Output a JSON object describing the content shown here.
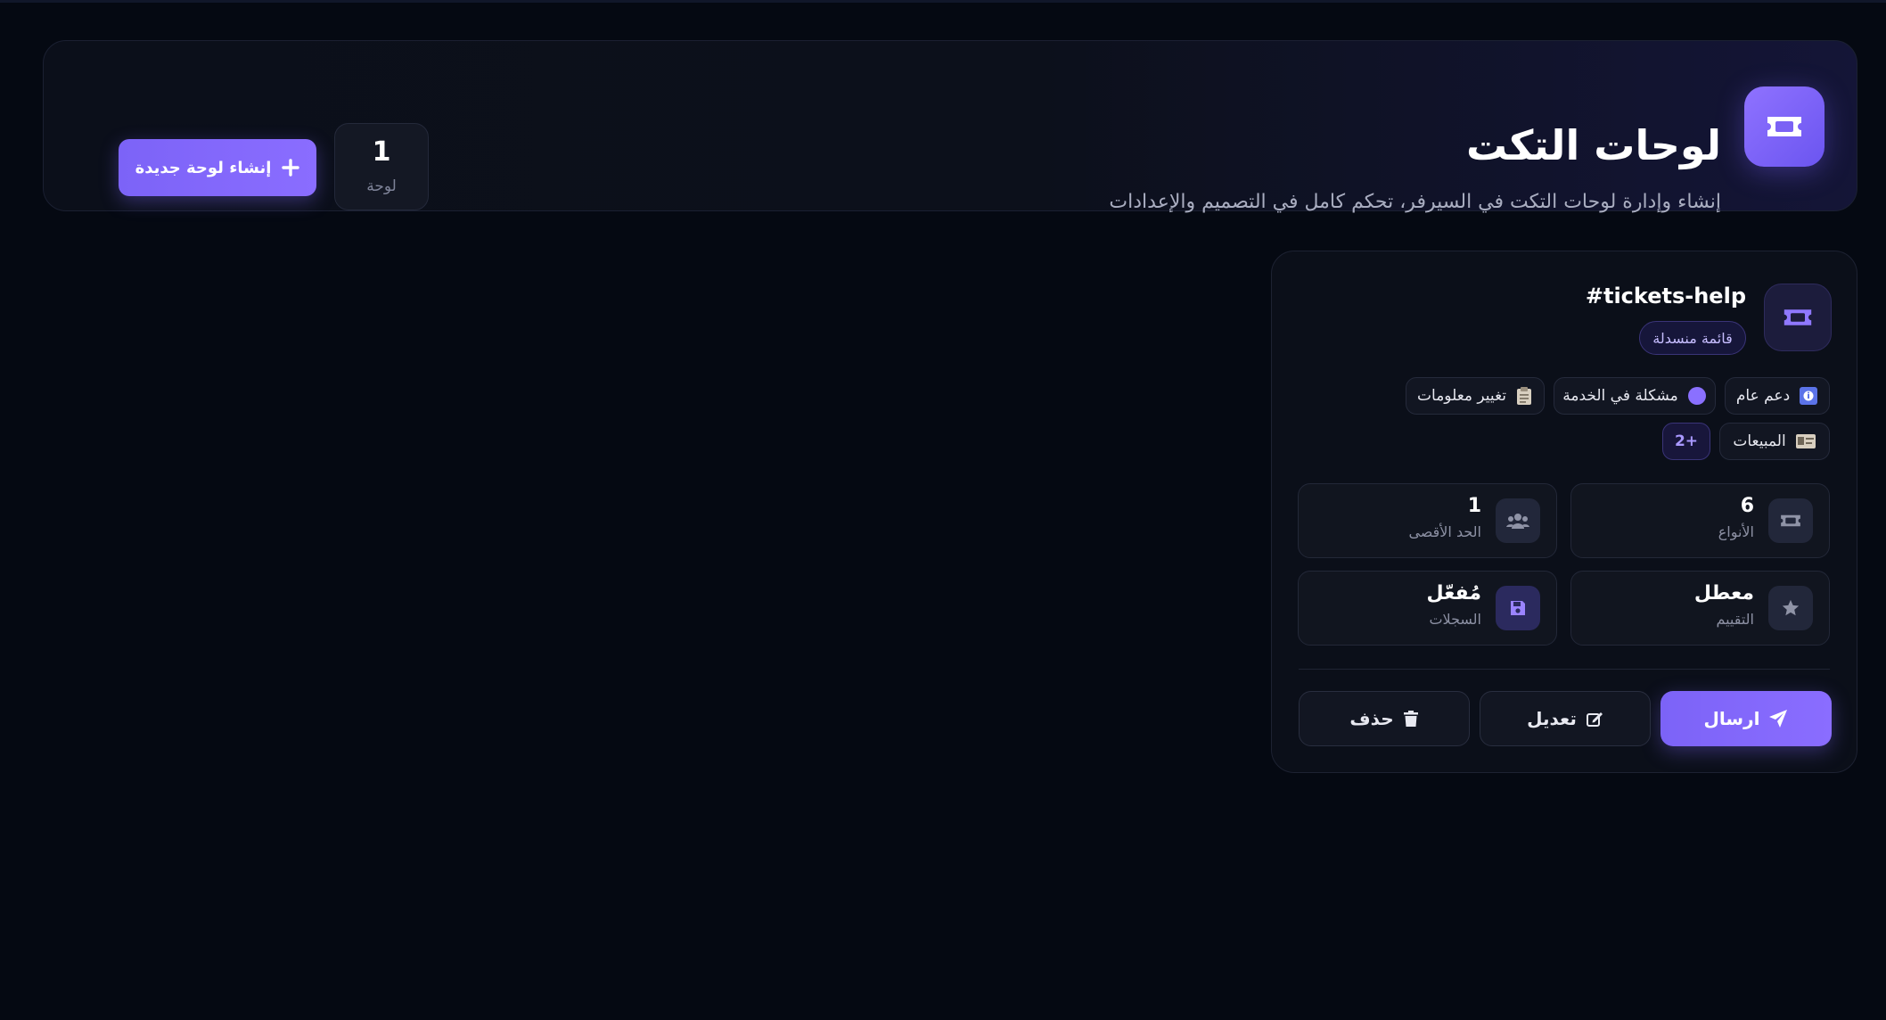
{
  "header": {
    "title": "لوحات التكت",
    "subtitle": "إنشاء وإدارة لوحات التكت في السيرفر، تحكم كامل في التصميم والإعدادات",
    "count_value": "1",
    "count_label": "لوحة",
    "create_button": "إنشاء لوحة جديدة"
  },
  "panel": {
    "channel": "#tickets-help",
    "mode_badge": "قائمة منسدلة",
    "categories": [
      {
        "icon": "info-icon",
        "label": "دعم عام"
      },
      {
        "icon": "purple-circle-icon",
        "label": "مشكلة في الخدمة"
      },
      {
        "icon": "clipboard-icon",
        "label": "تغيير معلومات"
      },
      {
        "icon": "id-card-icon",
        "label": "المبيعات"
      }
    ],
    "more_count": "+2",
    "stats": {
      "types": {
        "value": "6",
        "label": "الأنواع"
      },
      "max": {
        "value": "1",
        "label": "الحد الأقصى"
      },
      "rating": {
        "value": "معطل",
        "label": "التقييم"
      },
      "logs": {
        "value": "مُفعّل",
        "label": "السجلات"
      }
    },
    "actions": {
      "send": "ارسال",
      "edit": "تعديل",
      "delete": "حذف"
    }
  },
  "colors": {
    "accent": "#7c63f7",
    "background": "#050912",
    "card": "#0b0f19"
  }
}
